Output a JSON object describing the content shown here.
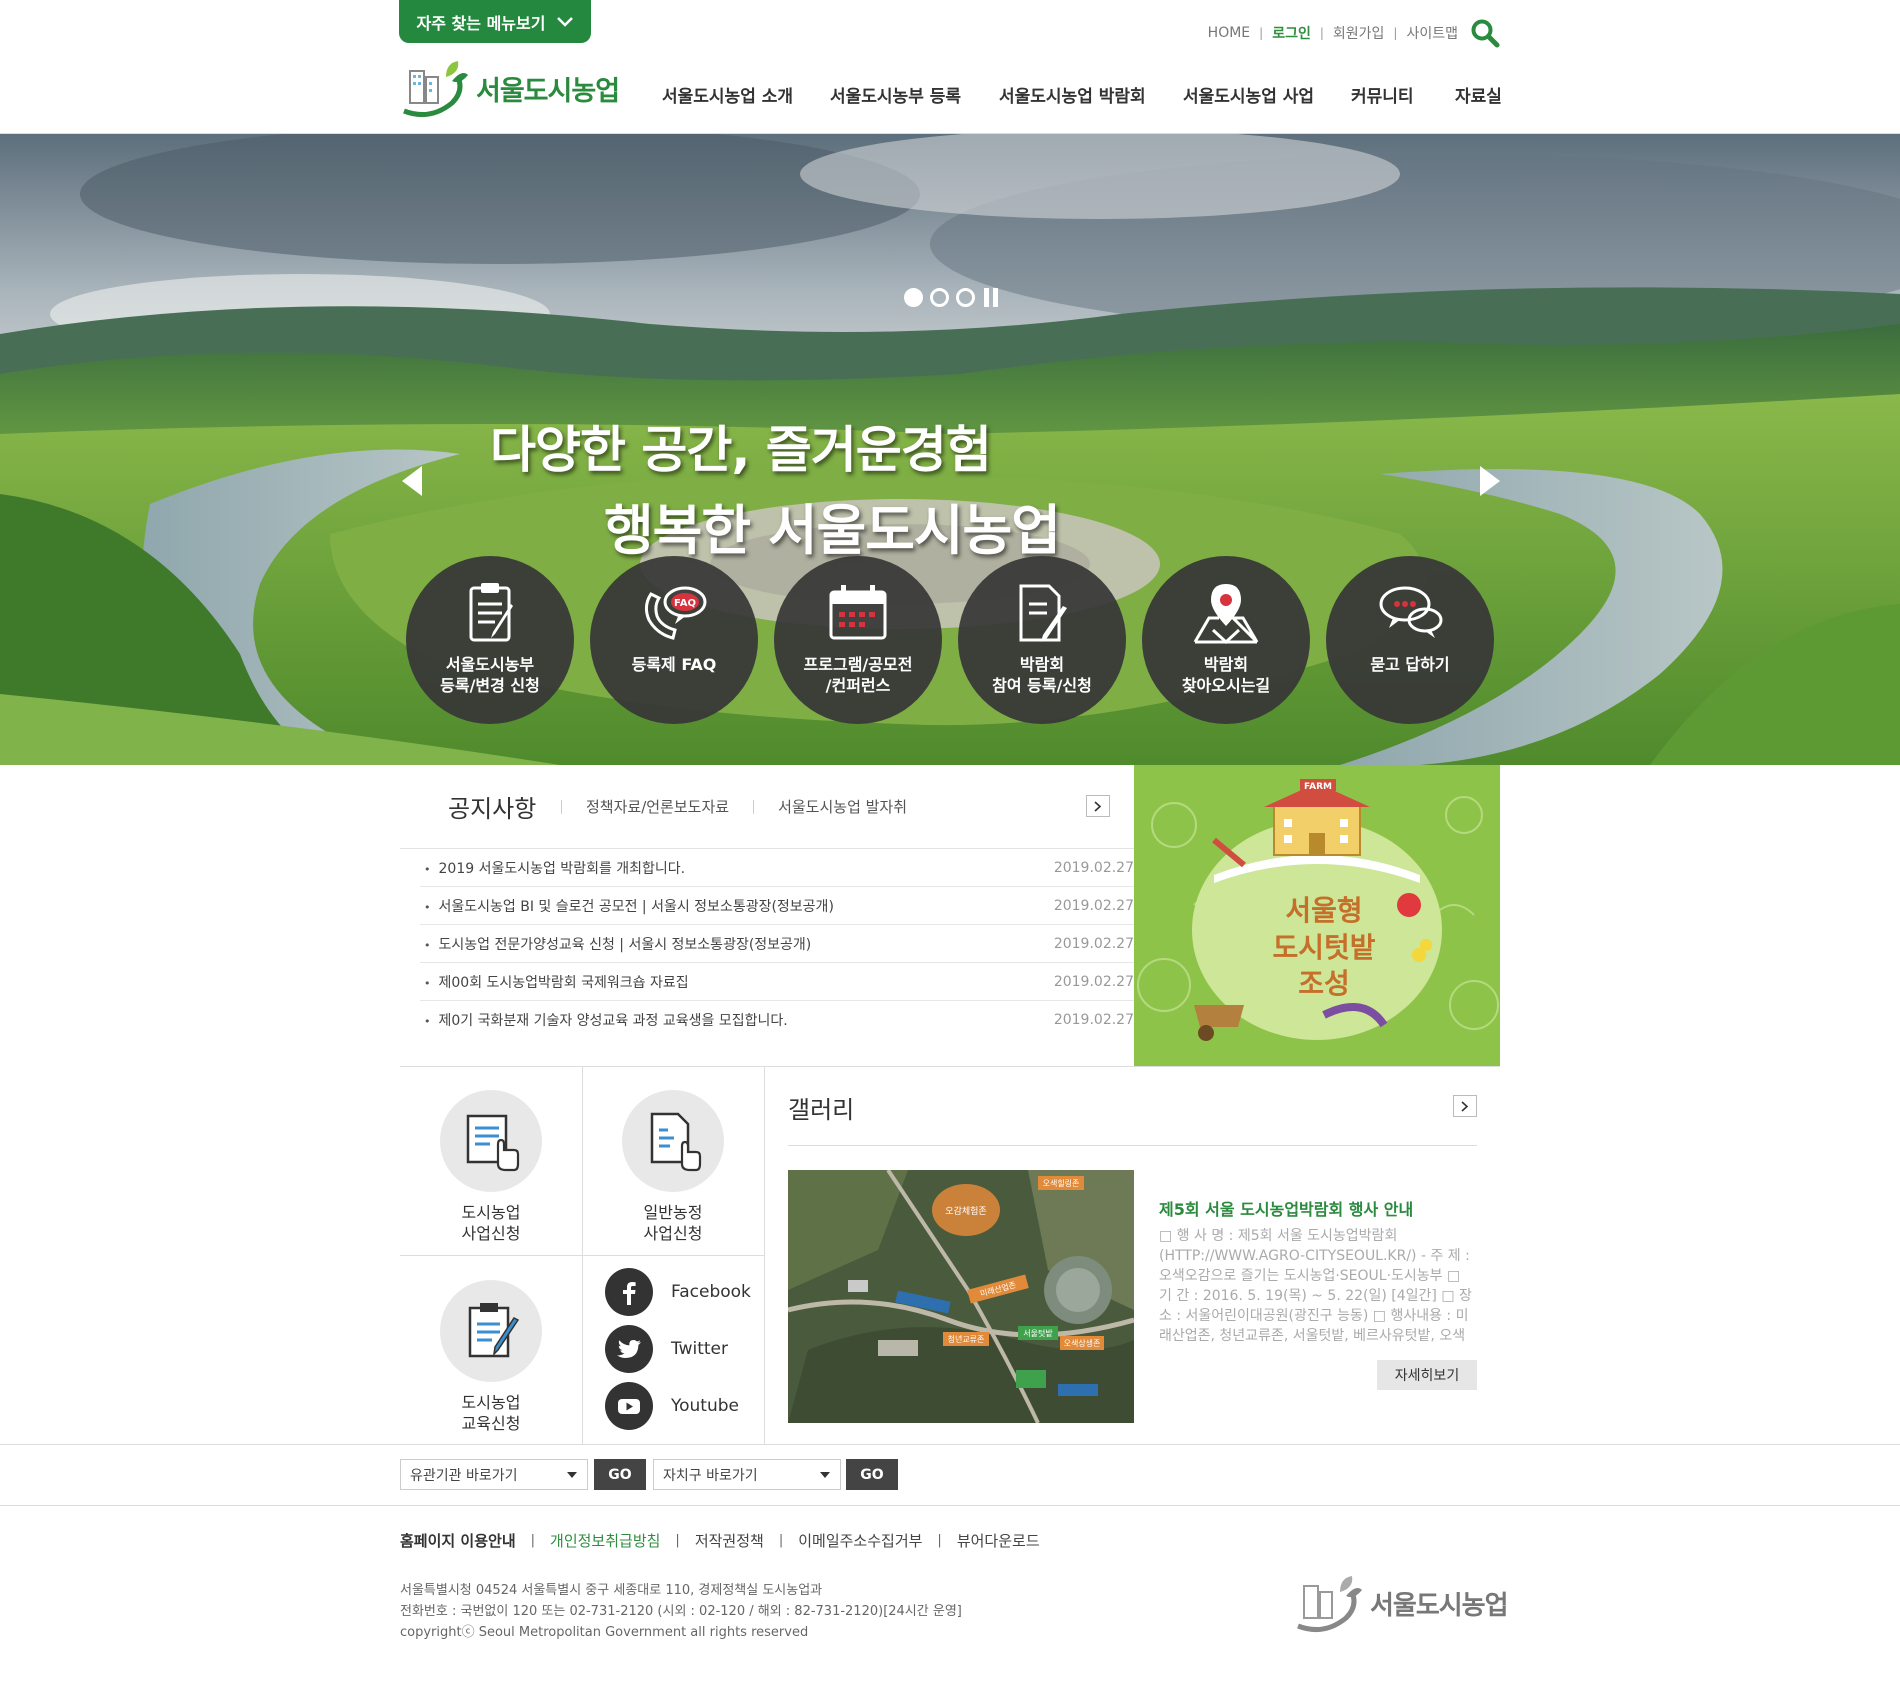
{
  "header": {
    "quick_menu_label": "자주 찾는 메뉴보기",
    "util_links": [
      "HOME",
      "로그인",
      "회원가입",
      "사이트맵"
    ],
    "logo_text": "서울도시농업",
    "nav": [
      "서울도시농업 소개",
      "서울도시농부 등록",
      "서울도시농업 박람회",
      "서울도시농업 사업",
      "커뮤니티",
      "자료실"
    ]
  },
  "hero": {
    "title_line1": "다양한 공간, 즐거운경험",
    "title_line2": "행복한 서울도시농업",
    "slides_total": 3,
    "slide_active": 1,
    "quick_buttons": [
      {
        "label": "서울도시농부\n등록/변경 신청",
        "icon": "clipboard-icon"
      },
      {
        "label": "등록제 FAQ",
        "icon": "faq-chat-icon"
      },
      {
        "label": "프로그램/공모전\n/컨퍼런스",
        "icon": "calendar-icon"
      },
      {
        "label": "박람회\n참여 등록/신청",
        "icon": "document-pen-icon"
      },
      {
        "label": "박람회\n찾아오시는길",
        "icon": "map-pin-icon"
      },
      {
        "label": "묻고 답하기",
        "icon": "speech-bubbles-icon"
      }
    ]
  },
  "notice": {
    "tab_main": "공지사항",
    "tabs": [
      "정책자료/언론보도자료",
      "서울도시농업 발자취"
    ],
    "items": [
      {
        "title": "2019 서울도시농업 박람회를 개최합니다.",
        "date": "2019.02.27"
      },
      {
        "title": "서울도시농업 BI 및 슬로건 공모전  | 서울시 정보소통광장(정보공개)",
        "date": "2019.02.27"
      },
      {
        "title": "도시농업 전문가양성교육 신청  | 서울시 정보소통광장(정보공개)",
        "date": "2019.02.27"
      },
      {
        "title": "제00회 도시농업박람회 국제워크숍 자료집",
        "date": "2019.02.27"
      },
      {
        "title": "제0기 국화분재 기술자 양성교육 과정 교육생을 모집합니다.",
        "date": "2019.02.27"
      }
    ]
  },
  "promo": {
    "text_line1": "서울형",
    "text_line2": "도시텃밭",
    "text_line3": "조성",
    "sign": "FARM"
  },
  "services": [
    {
      "label": "도시농업\n사업신청",
      "icon": "form-click-icon"
    },
    {
      "label": "일반농정\n사업신청",
      "icon": "document-click-icon"
    },
    {
      "label": "도시농업\n교육신청",
      "icon": "clipboard-pen-icon"
    }
  ],
  "social": [
    {
      "label": "Facebook",
      "icon": "facebook-icon"
    },
    {
      "label": "Twitter",
      "icon": "twitter-icon"
    },
    {
      "label": "Youtube",
      "icon": "youtube-icon"
    }
  ],
  "gallery": {
    "title": "갤러리",
    "headline": "제5회 서울 도시농업박람회 행사 안내",
    "body": "□ 행 사 명 : 제5회 서울 도시농업박람회(HTTP://WWW.AGRO-CITYSEOUL.KR/) - 주 제 : 오색오감으로 즐기는 도시농업·SEOUL·도시농부 □ 기 간 : 2016. 5. 19(목) ~ 5. 22(일) [4일간] □ 장 소 : 서울어린이대공원(광진구 능동) □ 행사내용 : 미래산업존, 청년교류존, 서울텃밭, 베르사유텃밭, 오색힐링존, 오감...",
    "more_label": "자세히보기",
    "map_labels": [
      "오색힐링존",
      "오감체험존",
      "미래산업존",
      "서울텃밭",
      "오색상생존",
      "청년교류존"
    ]
  },
  "site_links": {
    "select1": "유관기관 바로가기",
    "select2": "자치구 바로가기",
    "go_label": "GO"
  },
  "footer": {
    "links": [
      "홈페이지 이용안내",
      "개인정보취급방침",
      "저작권정책",
      "이메일주소수집거부",
      "뷰어다운로드"
    ],
    "address": "서울특별시청 04524 서울특별시 중구 세종대로 110, 경제정책실 도시농업과",
    "phone": "전화번호 : 국번없이 120 또는 02-731-2120 (시외 : 02-120 / 해외 : 82-731-2120)[24시간 운영]",
    "copyright": "copyrightⓒ Seoul Metropolitan Government all rights reserved",
    "logo_text": "서울도시농업"
  },
  "colors": {
    "brand_green": "#24883f",
    "dark_button": "#444444",
    "quick_circle": "#373737"
  }
}
